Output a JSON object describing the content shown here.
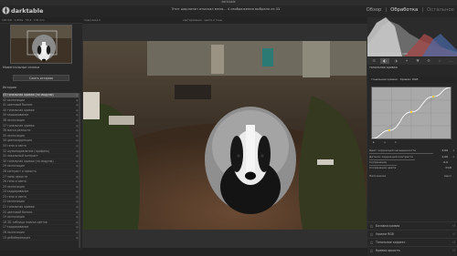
{
  "titlebar": {
    "title": "darktable"
  },
  "app": {
    "name": "darktable"
  },
  "header": {
    "album": "Этот шарлатан отыскал меня… 4 изображения выбрано из 43",
    "views": [
      {
        "label": "Обзор",
        "state": "normal"
      },
      {
        "label": "Обработка",
        "state": "active"
      },
      {
        "label": "Остальное",
        "state": "dim"
      }
    ]
  },
  "left_toolbar": {
    "text": "100 ISO · 1/250s · f/5.6 · 135 mm"
  },
  "left_panel": {
    "module_header": "Моментальные снимки",
    "reset_button": "Сжать историю",
    "history_title": "История",
    "history": [
      {
        "n": "43",
        "label": "тональная кривая (по модулю)",
        "selected": true
      },
      {
        "n": "42",
        "label": "экспозиция"
      },
      {
        "n": "41",
        "label": "цветовой баланс"
      },
      {
        "n": "40",
        "label": "тональная кривая"
      },
      {
        "n": "39",
        "label": "кадрирование"
      },
      {
        "n": "38",
        "label": "экспозиция"
      },
      {
        "n": "37",
        "label": "тональная кривая"
      },
      {
        "n": "36",
        "label": "маска резкости"
      },
      {
        "n": "35",
        "label": "экспозиция"
      },
      {
        "n": "34",
        "label": "цветокоррекция"
      },
      {
        "n": "33",
        "label": "тени и света"
      },
      {
        "n": "32",
        "label": "шумоподавление (профиль)"
      },
      {
        "n": "31",
        "label": "локальный контраст"
      },
      {
        "n": "30",
        "label": "тональная кривая (по модулю)"
      },
      {
        "n": "29",
        "label": "экспозиция"
      },
      {
        "n": "28",
        "label": "контраст и яркость"
      },
      {
        "n": "27",
        "label": "зоны яркости"
      },
      {
        "n": "26",
        "label": "тени и света"
      },
      {
        "n": "25",
        "label": "экспозиция"
      },
      {
        "n": "24",
        "label": "кадрирование"
      },
      {
        "n": "23",
        "label": "тени и света"
      },
      {
        "n": "22",
        "label": "экспозиция"
      },
      {
        "n": "21",
        "label": "тональная кривая"
      },
      {
        "n": "20",
        "label": "цветовой баланс"
      },
      {
        "n": "19",
        "label": "экспозиция"
      },
      {
        "n": "18",
        "label": "3D-таблица поиска цветов"
      },
      {
        "n": "17",
        "label": "кадрирование"
      },
      {
        "n": "16",
        "label": "экспозиция"
      },
      {
        "n": "15",
        "label": "дебайеризация"
      }
    ]
  },
  "center_toolbar": {
    "left": "подсказка ▾",
    "right": "картирование · цвета и тоны"
  },
  "histogram": {
    "info": "1/250 f/5.6 135 mm ISO 100"
  },
  "right_panel": {
    "tabs": [
      "☰",
      "◐",
      "◑",
      "✦",
      "♥",
      "⚙",
      "☆",
      "…"
    ],
    "module_title": "тональная кривая",
    "preset_label": "тональная кривая · Кривая: RGB",
    "curve_tabs": [
      "L",
      "a",
      "b"
    ],
    "colors": {
      "curve_bg": "#a9a9a9",
      "curve_line": "#ffffff",
      "curve_grid": "#8f8f8f",
      "point": "#ffd23a"
    },
    "curve_points": [
      [
        0,
        0
      ],
      [
        0.22,
        0.16
      ],
      [
        0.5,
        0.52
      ],
      [
        0.78,
        0.82
      ],
      [
        1,
        1
      ]
    ],
    "sliders": [
      {
        "label": "Цвет: коррекция насыщенности",
        "value": "2.00"
      },
      {
        "label": "Детали: коррекция контраста",
        "value": "1.00"
      },
      {
        "label": "Сохранение",
        "value": "0.0"
      }
    ],
    "preserve_label": "Сохранение цвета",
    "preserve_value": "RGB",
    "blend_label": "Наложение",
    "blend_value": "выкл",
    "modules": [
      {
        "label": "Базовая кривая",
        "icon": "↺"
      },
      {
        "label": "Уровни RGB",
        "icon": "↺"
      },
      {
        "label": "Тональное коррект.",
        "icon": "↺"
      },
      {
        "label": "Кривая яркости",
        "icon": "↺"
      }
    ]
  }
}
